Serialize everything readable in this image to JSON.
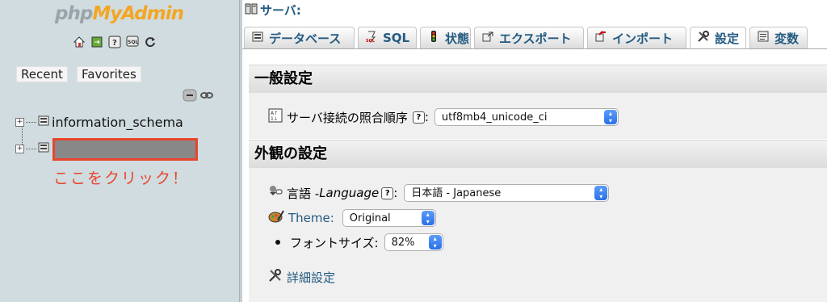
{
  "logo": {
    "part1": "php",
    "part2": "MyAdmin"
  },
  "nav": {
    "recent_label": "Recent",
    "favorites_label": "Favorites",
    "databases": [
      {
        "name": "information_schema"
      },
      {
        "name": ""
      }
    ],
    "click_note": "ここをクリック！"
  },
  "breadcrumb": {
    "server_label": "サーバ:"
  },
  "tabs": [
    {
      "label": "データベース",
      "icon": "database-icon"
    },
    {
      "label": "SQL",
      "icon": "sql-icon"
    },
    {
      "label": "状態",
      "icon": "status-icon"
    },
    {
      "label": "エクスポート",
      "icon": "export-icon"
    },
    {
      "label": "インポート",
      "icon": "import-icon"
    },
    {
      "label": "設定",
      "icon": "settings-icon"
    },
    {
      "label": "変数",
      "icon": "variables-icon"
    }
  ],
  "general": {
    "heading": "一般設定",
    "collation_label": "サーバ接続の照合順序",
    "collation_value": "utf8mb4_unicode_ci"
  },
  "appearance": {
    "heading": "外観の設定",
    "language_label": "言語 - ",
    "language_label_em": "Language",
    "language_value": "日本語 - Japanese",
    "theme_label": "Theme:",
    "theme_value": "Original",
    "fontsize_label": "フォントサイズ:",
    "fontsize_value": "82%",
    "more_settings": "詳細設定"
  },
  "colors": {
    "link": "#235a81",
    "highlight": "#e8452c",
    "nav_bg": "#d0dce0"
  }
}
